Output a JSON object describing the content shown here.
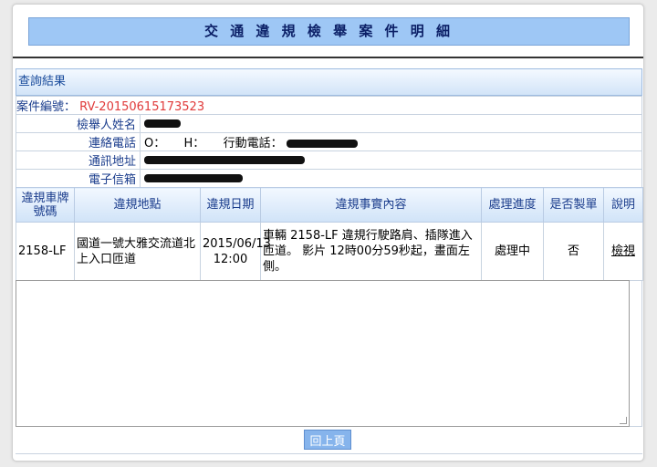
{
  "title": "交 通 違 規 檢 舉 案 件 明 細",
  "result_header": "查詢結果",
  "case": {
    "label": "案件編號：",
    "number": "RV-20150615173523"
  },
  "reporter": {
    "name_label": "檢舉人姓名",
    "phone_label": "連絡電話",
    "phone_o": "O：",
    "phone_h": "H：",
    "mobile_label": "行動電話：",
    "address_label": "通訊地址",
    "email_label": "電子信箱"
  },
  "table": {
    "headers": [
      "違規車牌號碼",
      "違規地點",
      "違規日期",
      "違規事實內容",
      "處理進度",
      "是否製單",
      "說明"
    ],
    "row": {
      "plate": "2158-LF",
      "location": "國道一號大雅交流道北上入口匝道",
      "date": "2015/06/13",
      "time": "12:00",
      "content": "車輛 2158-LF 違規行駛路肩、插隊進入匝道。 影片 12時00分59秒起，畫面左側。",
      "status": "處理中",
      "ticketed": "否",
      "action": "檢視"
    }
  },
  "back_button": "回上頁",
  "colors": {
    "title_bg": "#9ec7f5",
    "header_bg": "#d2e4f8",
    "case_number": "#e03a3a",
    "button_bg": "#86b4ec"
  }
}
